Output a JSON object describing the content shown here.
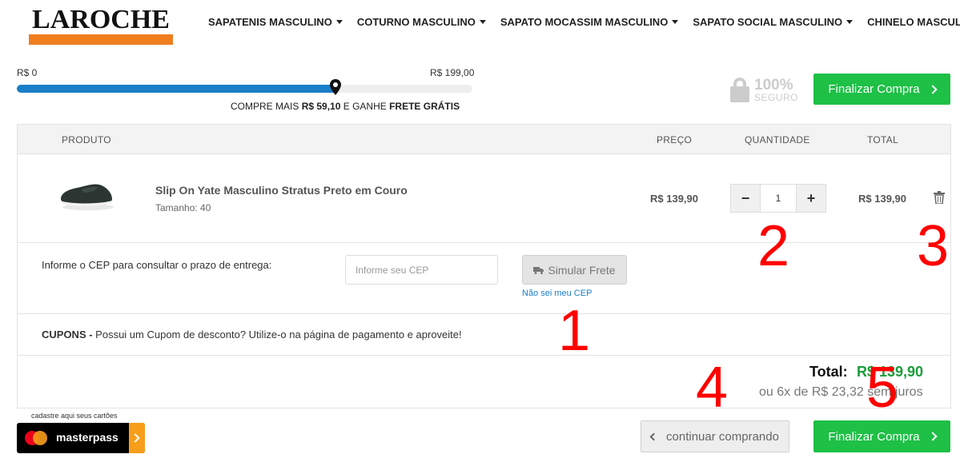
{
  "header": {
    "logo_text": "LAROCHE",
    "nav": [
      {
        "label": "SAPATENIS MASCULINO"
      },
      {
        "label": "COTURNO MASCULINO"
      },
      {
        "label": "SAPATO MOCASSIM MASCULINO"
      },
      {
        "label": "SAPATO SOCIAL MASCULINO"
      },
      {
        "label": "CHINELO MASCULINO"
      }
    ]
  },
  "shipping_progress": {
    "min_label": "R$ 0",
    "max_label": "R$ 199,00",
    "progress_fraction": 0.7,
    "message_prefix": "COMPRE MAIS ",
    "message_amount": "R$ 59,10",
    "message_middle": " E GANHE ",
    "message_bold": "FRETE GRÁTIS",
    "fill_color": "#1a7ec8"
  },
  "secure_badge": {
    "percent": "100%",
    "label": "SEGURO",
    "icon": "lock-icon"
  },
  "checkout_top": {
    "label": "Finalizar Compra"
  },
  "table": {
    "headers": {
      "product": "PRODUTO",
      "price": "PREÇO",
      "quantity": "QUANTIDADE",
      "total": "TOTAL"
    },
    "items": [
      {
        "name": "Slip On Yate Masculino Stratus Preto em Couro",
        "size": "Tamanho: 40",
        "price": "R$ 139,90",
        "quantity": "1",
        "total": "R$ 139,90"
      }
    ]
  },
  "shipping": {
    "label": "Informe o CEP para consultar o prazo de entrega:",
    "placeholder": "Informe seu CEP",
    "simulate_label": "Simular Frete",
    "link": "Não sei meu CEP"
  },
  "coupons": {
    "bold": "CUPONS -",
    "text": " Possui um Cupom de desconto? Utilize-o na página de pagamento e aproveite!"
  },
  "summary": {
    "total_label": "Total:",
    "total_value": "R$ 139,90",
    "installments": "ou 6x de R$ 23,32 sem juros"
  },
  "masterpass": {
    "caption": "cadastre aqui seus cartões",
    "label": "masterpass"
  },
  "footer_buttons": {
    "continue_label": "continuar comprando",
    "checkout_label": "Finalizar Compra"
  },
  "annotations": [
    "1",
    "2",
    "3",
    "4",
    "5"
  ],
  "colors": {
    "accent_green": "#1ec046",
    "brand_orange": "#f07d1e",
    "annotation_red": "#ff0000",
    "total_green": "#1a9c3a"
  }
}
